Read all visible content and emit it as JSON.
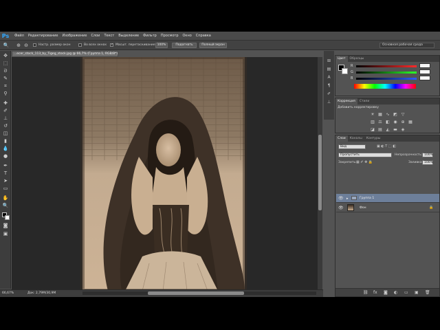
{
  "app": {
    "logo": "Ps"
  },
  "menu": [
    "Файл",
    "Редактирование",
    "Изображение",
    "Слои",
    "Текст",
    "Выделение",
    "Фильтр",
    "Просмотр",
    "Окно",
    "Справка"
  ],
  "options": {
    "resize_windows": "Настр. размер окон",
    "all_windows": "Во всех окнах",
    "scrubby_zoom": "Масшт. перетаскиванием",
    "zoom_100": "100%",
    "fit_screen": "Подогнать",
    "fill_screen": "Полный экран",
    "workspace": "Основная рабочая среда"
  },
  "document": {
    "tab_title": "...ecer_stock_113_by_Tigeg_stock.jpg @ 66,7% (Группа 1, RGB/8*) *",
    "zoom": "66,67%",
    "doc_info": "Док: 2,79М/30,9М"
  },
  "color_panel": {
    "tabs": [
      "Цвет",
      "Образцы"
    ],
    "channels": [
      "R",
      "G",
      "B"
    ],
    "colors": {
      "r": "#d23a3a",
      "g": "#3ab83a",
      "b": "#3a5ad2"
    }
  },
  "adjustments_panel": {
    "tabs": [
      "Коррекция",
      "Стили"
    ],
    "title": "Добавить корректировку"
  },
  "layers_panel": {
    "tabs": [
      "Слои",
      "Каналы",
      "Контуры"
    ],
    "filter": "Вид",
    "blend_mode": "Пропустить",
    "opacity_label": "Непрозрачность:",
    "opacity": "100%",
    "lock_label": "Закрепить:",
    "fill_label": "Заливка:",
    "fill": "100%",
    "layers": [
      {
        "name": "Группа 1",
        "selected": true
      },
      {
        "name": "Фон",
        "selected": false
      }
    ]
  }
}
